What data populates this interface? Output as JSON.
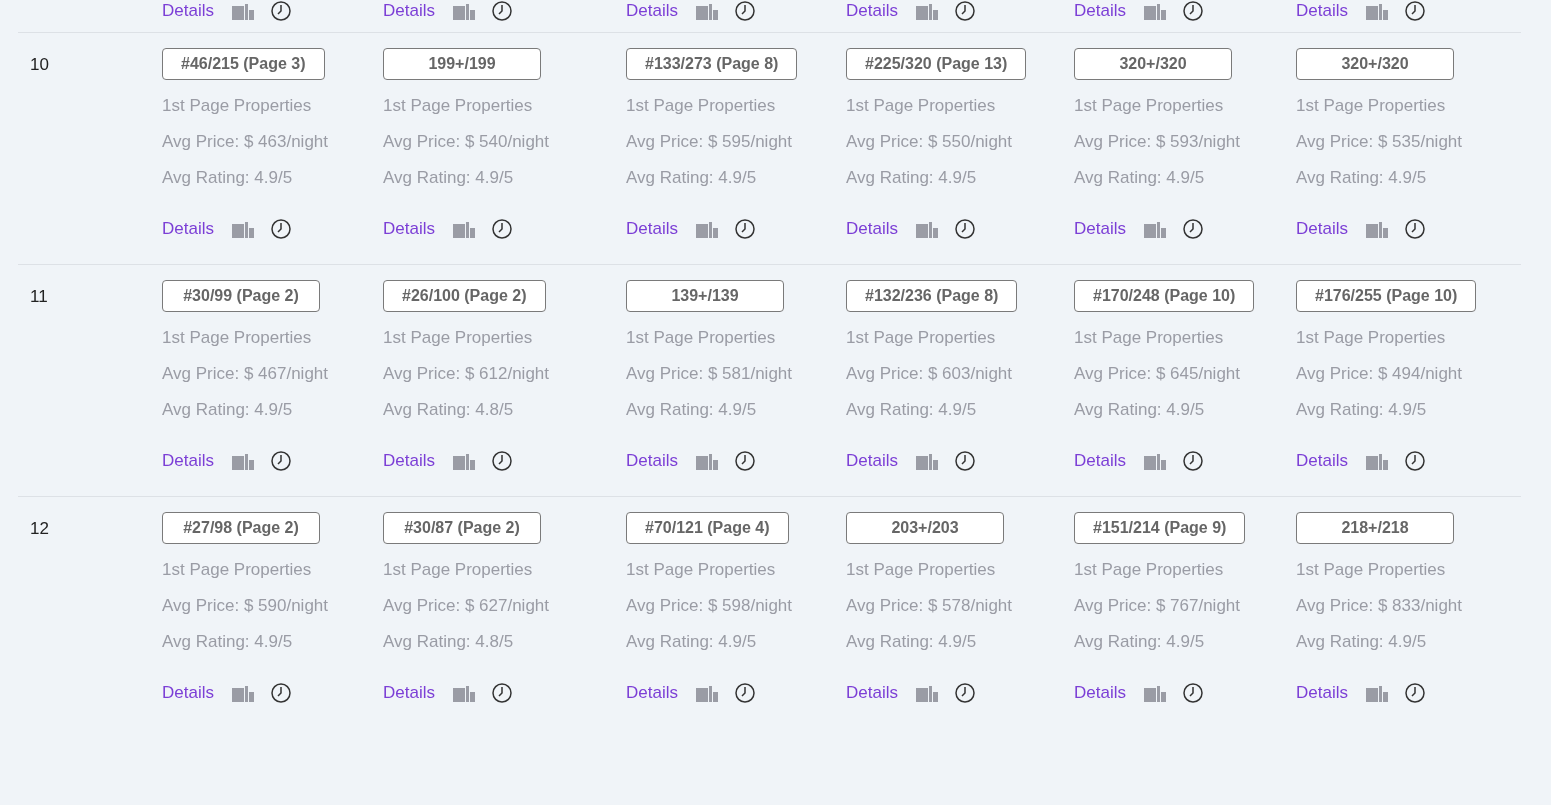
{
  "partial_row": {
    "cells": [
      {
        "link": "Details"
      },
      {
        "link": "Details"
      },
      {
        "link": "Details"
      },
      {
        "link": "Details"
      },
      {
        "link": "Details"
      },
      {
        "link": "Details"
      }
    ]
  },
  "rows": [
    {
      "label": "10",
      "cells": [
        {
          "rank": "#46/215 (Page 3)",
          "properties": "1st Page Properties",
          "price": "Avg Price: $ 463/night",
          "rating": "Avg Rating: 4.9/5",
          "link": "Details"
        },
        {
          "rank": "199+/199",
          "properties": "1st Page Properties",
          "price": "Avg Price: $ 540/night",
          "rating": "Avg Rating: 4.9/5",
          "link": "Details"
        },
        {
          "rank": "#133/273 (Page 8)",
          "properties": "1st Page Properties",
          "price": "Avg Price: $ 595/night",
          "rating": "Avg Rating: 4.9/5",
          "link": "Details"
        },
        {
          "rank": "#225/320 (Page 13)",
          "properties": "1st Page Properties",
          "price": "Avg Price: $ 550/night",
          "rating": "Avg Rating: 4.9/5",
          "link": "Details"
        },
        {
          "rank": "320+/320",
          "properties": "1st Page Properties",
          "price": "Avg Price: $ 593/night",
          "rating": "Avg Rating: 4.9/5",
          "link": "Details"
        },
        {
          "rank": "320+/320",
          "properties": "1st Page Properties",
          "price": "Avg Price: $ 535/night",
          "rating": "Avg Rating: 4.9/5",
          "link": "Details"
        }
      ]
    },
    {
      "label": "11",
      "cells": [
        {
          "rank": "#30/99 (Page 2)",
          "properties": "1st Page Properties",
          "price": "Avg Price: $ 467/night",
          "rating": "Avg Rating: 4.9/5",
          "link": "Details"
        },
        {
          "rank": "#26/100 (Page 2)",
          "properties": "1st Page Properties",
          "price": "Avg Price: $ 612/night",
          "rating": "Avg Rating: 4.8/5",
          "link": "Details"
        },
        {
          "rank": "139+/139",
          "properties": "1st Page Properties",
          "price": "Avg Price: $ 581/night",
          "rating": "Avg Rating: 4.9/5",
          "link": "Details"
        },
        {
          "rank": "#132/236 (Page 8)",
          "properties": "1st Page Properties",
          "price": "Avg Price: $ 603/night",
          "rating": "Avg Rating: 4.9/5",
          "link": "Details"
        },
        {
          "rank": "#170/248 (Page 10)",
          "properties": "1st Page Properties",
          "price": "Avg Price: $ 645/night",
          "rating": "Avg Rating: 4.9/5",
          "link": "Details"
        },
        {
          "rank": "#176/255 (Page 10)",
          "properties": "1st Page Properties",
          "price": "Avg Price: $ 494/night",
          "rating": "Avg Rating: 4.9/5",
          "link": "Details"
        }
      ]
    },
    {
      "label": "12",
      "cells": [
        {
          "rank": "#27/98 (Page 2)",
          "properties": "1st Page Properties",
          "price": "Avg Price: $ 590/night",
          "rating": "Avg Rating: 4.9/5",
          "link": "Details"
        },
        {
          "rank": "#30/87 (Page 2)",
          "properties": "1st Page Properties",
          "price": "Avg Price: $ 627/night",
          "rating": "Avg Rating: 4.8/5",
          "link": "Details"
        },
        {
          "rank": "#70/121 (Page 4)",
          "properties": "1st Page Properties",
          "price": "Avg Price: $ 598/night",
          "rating": "Avg Rating: 4.9/5",
          "link": "Details"
        },
        {
          "rank": "203+/203",
          "properties": "1st Page Properties",
          "price": "Avg Price: $ 578/night",
          "rating": "Avg Rating: 4.9/5",
          "link": "Details"
        },
        {
          "rank": "#151/214 (Page 9)",
          "properties": "1st Page Properties",
          "price": "Avg Price: $ 767/night",
          "rating": "Avg Rating: 4.9/5",
          "link": "Details"
        },
        {
          "rank": "218+/218",
          "properties": "1st Page Properties",
          "price": "Avg Price: $ 833/night",
          "rating": "Avg Rating: 4.9/5",
          "link": "Details"
        }
      ]
    }
  ]
}
